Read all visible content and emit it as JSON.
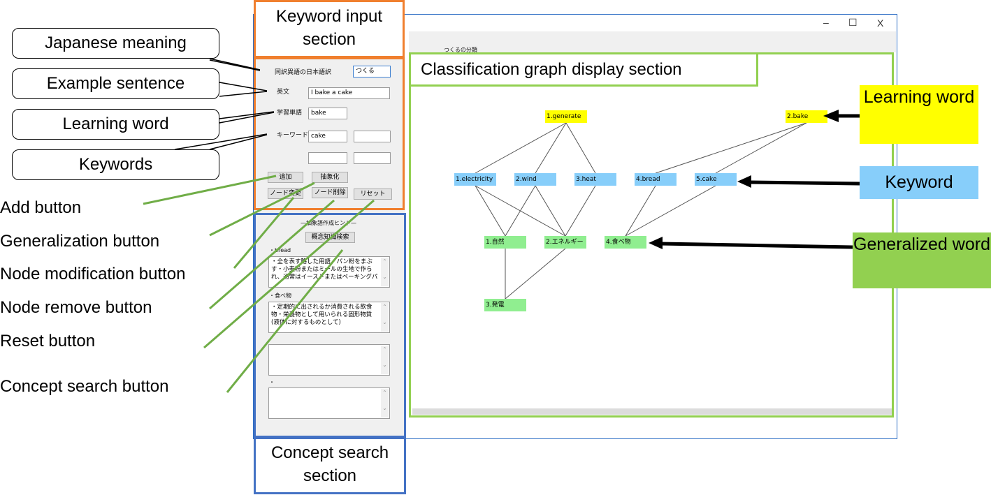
{
  "window": {
    "title": "つくるの分類",
    "controls": {
      "minimize": "–",
      "maximize": "☐",
      "close": "X"
    }
  },
  "keyword_input": {
    "japanese_label": "同訳異語の日本語訳",
    "japanese_value": "つくる",
    "sentence_label": "英文",
    "sentence_value": "I bake a cake",
    "learning_label": "学習単語",
    "learning_value": "bake",
    "keyword_label": "キーワード",
    "keyword_values": [
      "cake",
      "",
      "",
      ""
    ],
    "buttons": {
      "add": "追加",
      "generalize": "抽象化",
      "modify": "ノード変更",
      "remove": "ノード削除",
      "reset": "リセット"
    }
  },
  "concept_search": {
    "heading": "—抽象語作成ヒント—",
    "search_button": "概念知識検索",
    "entries": [
      {
        "word": "・bread",
        "text": "・全を表す略した用語・パン粉をまぶす・小麦粉またはミールの生地で作られ、通常はイーストまたはベーキングパ"
      },
      {
        "word": "・食べ物",
        "text": "・定期的に出されるか消費される飲食物・栄養物として用いられる固形物質(液体に対するものとして)"
      },
      {
        "word": "",
        "text": ""
      },
      {
        "word": "・",
        "text": ""
      }
    ]
  },
  "graph": {
    "colors": {
      "learning": "#ffff00",
      "keyword": "#87cefa",
      "generalized": "#90ee90"
    },
    "nodes": [
      {
        "id": "generate",
        "label": "1.generate",
        "type": "learning"
      },
      {
        "id": "bake",
        "label": "2.bake",
        "type": "learning"
      },
      {
        "id": "electricity",
        "label": "1.electricity",
        "type": "keyword"
      },
      {
        "id": "wind",
        "label": "2.wind",
        "type": "keyword"
      },
      {
        "id": "heat",
        "label": "3.heat",
        "type": "keyword"
      },
      {
        "id": "bread",
        "label": "4.bread",
        "type": "keyword"
      },
      {
        "id": "cake",
        "label": "5.cake",
        "type": "keyword"
      },
      {
        "id": "nature",
        "label": "1.自然",
        "type": "generalized"
      },
      {
        "id": "energy",
        "label": "2.エネルギー",
        "type": "generalized"
      },
      {
        "id": "food",
        "label": "4.食べ物",
        "type": "generalized"
      },
      {
        "id": "power",
        "label": "3.発電",
        "type": "generalized"
      }
    ],
    "edges": [
      [
        "generate",
        "electricity"
      ],
      [
        "generate",
        "wind"
      ],
      [
        "generate",
        "heat"
      ],
      [
        "bake",
        "bread"
      ],
      [
        "bake",
        "cake"
      ],
      [
        "electricity",
        "nature"
      ],
      [
        "electricity",
        "energy"
      ],
      [
        "wind",
        "nature"
      ],
      [
        "wind",
        "energy"
      ],
      [
        "heat",
        "energy"
      ],
      [
        "bread",
        "food"
      ],
      [
        "cake",
        "food"
      ],
      [
        "nature",
        "power"
      ],
      [
        "energy",
        "power"
      ]
    ]
  },
  "annotations": {
    "sections": {
      "keyword_input": "Keyword input section",
      "concept_search": "Concept search section",
      "graph": "Classification graph display section"
    },
    "callouts": [
      "Japanese meaning",
      "Example sentence",
      "Learning word",
      "Keywords"
    ],
    "buttons": [
      "Add button",
      "Generalization button",
      "Node modification button",
      "Node remove button",
      "Reset button",
      "Concept search button"
    ],
    "legend": {
      "learning": "Learning word",
      "keyword": "Keyword",
      "generalized": "Generalized word"
    }
  }
}
